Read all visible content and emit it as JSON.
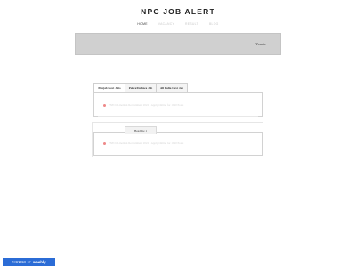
{
  "site": {
    "title": "NPC JOB ALERT"
  },
  "nav": [
    {
      "label": "HOME",
      "active": true
    },
    {
      "label": "VACANCY",
      "active": false
    },
    {
      "label": "RESULT",
      "active": false
    },
    {
      "label": "BLOG",
      "active": false
    }
  ],
  "banner": {
    "text": "Your te"
  },
  "tabs": [
    {
      "label": "Punjab Govt Jobs",
      "active": true
    },
    {
      "label": "Police/Defence Job",
      "active": false
    },
    {
      "label": "All India Govt Job",
      "active": false
    }
  ],
  "tab_panel": {
    "items": [
      {
        "text": "PSPCL Lineman Recruitment 2022 - Apply Online for 1690 Posts"
      }
    ]
  },
  "section": {
    "label": "Headline 1",
    "items": [
      {
        "text": "PSPCL Lineman Recruitment 2022 - Apply Online for 1690 Posts"
      }
    ]
  },
  "footer_badge": {
    "prefix": "POWERED BY",
    "brand": "weebly"
  },
  "colors": {
    "badge": "#2b6cd6",
    "banner": "#d0d0d0"
  }
}
